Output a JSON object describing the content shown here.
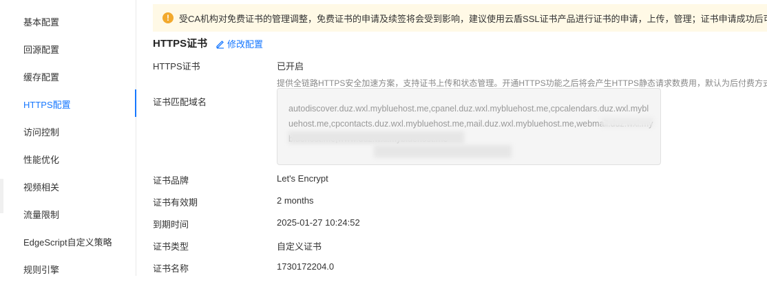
{
  "sidebar": {
    "items": [
      {
        "label": "基本配置"
      },
      {
        "label": "回源配置"
      },
      {
        "label": "缓存配置"
      },
      {
        "label": "HTTPS配置"
      },
      {
        "label": "访问控制"
      },
      {
        "label": "性能优化"
      },
      {
        "label": "视频相关"
      },
      {
        "label": "流量限制"
      },
      {
        "label": "EdgeScript自定义策略"
      },
      {
        "label": "规则引擎"
      }
    ],
    "active_index": 3
  },
  "notice": {
    "text": "受CA机构对免费证书的管理调整，免费证书的申请及续签将会受到影响，建议使用云盾SSL证书产品进行证书的申请，上传，管理；证书申请成功后可通过SSL证书"
  },
  "section": {
    "title": "HTTPS证书",
    "edit_label": "修改配置"
  },
  "fields": {
    "https_cert": {
      "label": "HTTPS证书",
      "value": "已开启"
    },
    "https_desc": "提供全链路HTTPS安全加速方案，支持证书上传和状态管理。开通HTTPS功能之后将会产生HTTPS静态请求数费用，默认为后付费方式，",
    "domains": {
      "label": "证书匹配域名",
      "value": "autodiscover.duz.wxl.mybluehost.me,cpanel.duz.wxl.mybluehost.me,cpcalendars.duz.wxl.mybluehost.me,cpcontacts.duz.wxl.mybluehost.me,mail.duz.wxl.mybluehost.me,webmail.duz.wxl.mybluehost.me,www.duz.wxl.mybluehost.me"
    },
    "brand": {
      "label": "证书品牌",
      "value": "Let's Encrypt"
    },
    "validity": {
      "label": "证书有效期",
      "value": "2 months"
    },
    "expiry": {
      "label": "到期时间",
      "value": "2025-01-27 10:24:52"
    },
    "type": {
      "label": "证书类型",
      "value": "自定义证书"
    },
    "name": {
      "label": "证书名称",
      "value": "1730172204.0"
    }
  },
  "colors": {
    "accent": "#1677ff",
    "warning": "#f2a92d",
    "notice_bg": "#fff9e6"
  }
}
